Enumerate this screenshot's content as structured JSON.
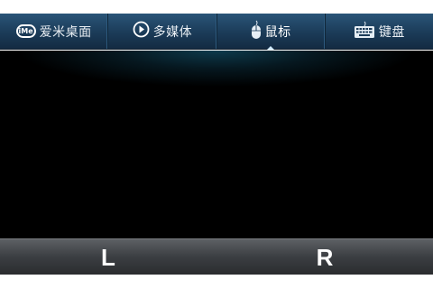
{
  "tabs": [
    {
      "label": "爱米桌面",
      "icon": "ime-logo-icon",
      "icon_text": "iMe",
      "active": false
    },
    {
      "label": "多媒体",
      "icon": "play-circle-icon",
      "active": false
    },
    {
      "label": "鼠标",
      "icon": "mouse-icon",
      "active": true
    },
    {
      "label": "键盘",
      "icon": "keyboard-icon",
      "active": false
    }
  ],
  "mouse_buttons": {
    "left_label": "L",
    "right_label": "R"
  },
  "colors": {
    "tabbar": "#1b3b58",
    "touchpad": "#000000",
    "button_bar": "#3b3e42"
  }
}
